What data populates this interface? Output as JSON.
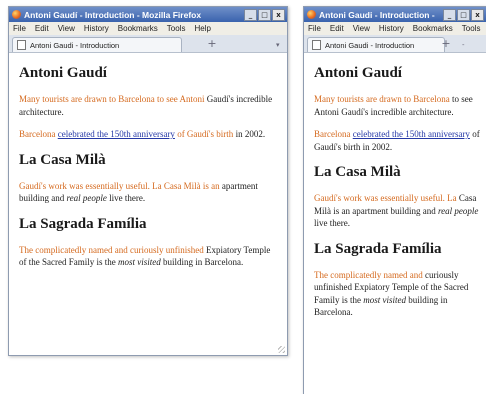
{
  "windows": [
    {
      "title": "Antoni Gaudí - Introduction - Mozilla Firefox",
      "menu": [
        "File",
        "Edit",
        "View",
        "History",
        "Bookmarks",
        "Tools",
        "Help"
      ],
      "tab_title": "Antoni Gaudi - Introduction",
      "new_tab": "+",
      "list_tabs": "▾",
      "page": {
        "h1": "Antoni Gaudí",
        "p1_hl": "Many tourists are drawn to Barcelona to see Antoni",
        "p1_rest": "Gaudí's incredible architecture.",
        "p2_pre": "Barcelona",
        "p2_link": "celebrated the 150th anniversary",
        "p2_post_hl": "of Gaudí's birth",
        "p2_post": "in 2002.",
        "h2a": "La Casa Milà",
        "p3_hl": "Gaudí's work was essentially useful. La Casa Milà is an",
        "p3_rest1": "apartment building and",
        "p3_em": "real people",
        "p3_rest2": "live there.",
        "h2b": "La Sagrada Família",
        "p4_hl": "The complicatedly named and curiously unfinished",
        "p4_rest1": "Expiatory Temple of the Sacred Family is the",
        "p4_em": "most visited",
        "p4_rest2": "building in Barcelona."
      }
    },
    {
      "title": "Antoni Gaudi - Introduction -",
      "menu": [
        "File",
        "Edit",
        "View",
        "History",
        "Bookmarks",
        "Tools"
      ],
      "tab_title": "Antoni Gaudi - Introduction",
      "new_tab": "+",
      "list_tabs": "-",
      "page": {
        "h1": "Antoni Gaudí",
        "p1_hl": "Many tourists are drawn to Barcelona",
        "p1_rest": "to see Antoni Gaudí's incredible architecture.",
        "p2_pre": "Barcelona",
        "p2_link": "celebrated the 150th anniversary",
        "p2_post": "of Gaudí's birth in 2002.",
        "h2a": "La Casa Milà",
        "p3_hl": "Gaudí's work was essentially useful. La",
        "p3_rest1": "Casa Milà is an apartment building and",
        "p3_em": "real people",
        "p3_rest2": "live there.",
        "h2b": "La Sagrada Família",
        "p4_hl": "The complicatedly named and",
        "p4_rest1": "curiously unfinished Expiatory Temple of the Sacred Family is the",
        "p4_em": "most visited",
        "p4_rest2": "building in Barcelona."
      }
    }
  ],
  "colors": {
    "highlight": "#d56a1f",
    "link": "#2538a6",
    "titlebar": "#3a63ad"
  }
}
